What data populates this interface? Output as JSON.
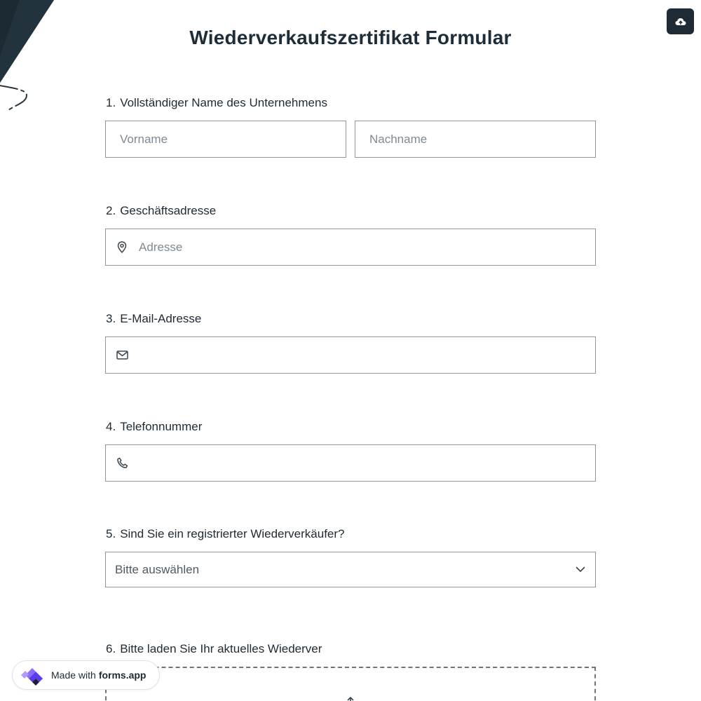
{
  "form": {
    "title": "Wiederverkaufszertifikat Formular"
  },
  "questions": [
    {
      "number": "1.",
      "label": "Vollständiger Name des Unternehmens",
      "first_name_placeholder": "Vorname",
      "last_name_placeholder": "Nachname"
    },
    {
      "number": "2.",
      "label": "Geschäftsadresse",
      "placeholder": "Adresse",
      "icon": "map-pin-icon"
    },
    {
      "number": "3.",
      "label": "E-Mail-Adresse",
      "placeholder": "",
      "icon": "envelope-icon"
    },
    {
      "number": "4.",
      "label": "Telefonnummer",
      "placeholder": "",
      "icon": "phone-icon"
    },
    {
      "number": "5.",
      "label": "Sind Sie ein registrierter Wiederverkäufer?",
      "selected": "Bitte auswählen",
      "icon": "chevron-down-icon"
    },
    {
      "number": "6.",
      "label": "Bitte laden Sie Ihr aktuelles Wiederver",
      "icon": "upload-icon"
    }
  ],
  "toolbar": {
    "save_icon": "cloud-upload-icon"
  },
  "badge": {
    "prefix": "Made with",
    "brand": "forms.app",
    "icon": "forms-app-logo"
  },
  "colors": {
    "accent_dark": "#1e2b35",
    "border": "#8e979e",
    "placeholder": "#808a92",
    "logo_purple": "#6c4bf4"
  }
}
